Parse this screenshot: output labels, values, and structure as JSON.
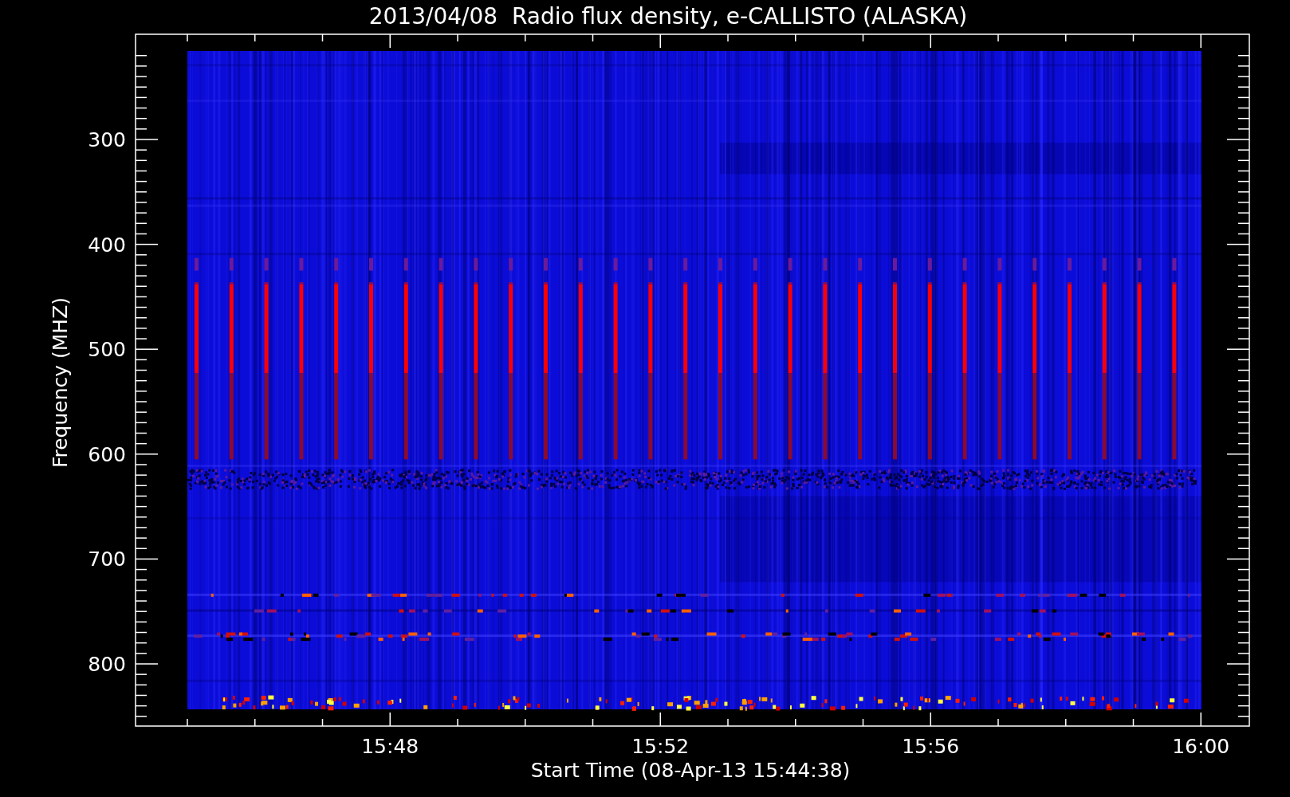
{
  "title": "2013/04/08  Radio flux density, e-CALLISTO (ALASKA)",
  "y_axis": {
    "label": "Frequency (MHZ)",
    "ticks": [
      "300",
      "400",
      "500",
      "600",
      "700",
      "800"
    ]
  },
  "x_axis": {
    "label": "Start Time (08-Apr-13 15:44:38)",
    "ticks": [
      "15:48",
      "15:52",
      "15:56",
      "16:00"
    ]
  }
}
